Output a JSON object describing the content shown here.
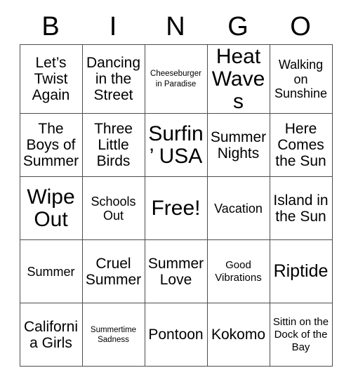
{
  "header": {
    "letters": [
      "B",
      "I",
      "N",
      "G",
      "O"
    ]
  },
  "grid": {
    "columns": 5,
    "rows": 5,
    "border_color": "#4d4d4d",
    "text_color": "#000000",
    "background_color": "#ffffff",
    "cells": [
      [
        {
          "label": "Let’s Twist Again",
          "size": "lg"
        },
        {
          "label": "Dancing in the Street",
          "size": "lg"
        },
        {
          "label": "Cheeseburger in Paradise",
          "size": "xs"
        },
        {
          "label": "Heat Waves",
          "size": "xxl"
        },
        {
          "label": "Walking on Sunshine",
          "size": "md"
        }
      ],
      [
        {
          "label": "The Boys of Summer",
          "size": "lg"
        },
        {
          "label": "Three Little Birds",
          "size": "lg"
        },
        {
          "label": "Surfin’ USA",
          "size": "xxl"
        },
        {
          "label": "Summer Nights",
          "size": "lg"
        },
        {
          "label": "Here Comes the Sun",
          "size": "lg"
        }
      ],
      [
        {
          "label": "Wipe Out",
          "size": "xxl"
        },
        {
          "label": "Schools Out",
          "size": "md"
        },
        {
          "label": "Free!",
          "size": "xxl"
        },
        {
          "label": "Vacation",
          "size": "md"
        },
        {
          "label": "Island in the Sun",
          "size": "lg"
        }
      ],
      [
        {
          "label": "Summer",
          "size": "md"
        },
        {
          "label": "Cruel Summer",
          "size": "lg"
        },
        {
          "label": "Summer Love",
          "size": "lg"
        },
        {
          "label": "Good Vibrations",
          "size": "sm"
        },
        {
          "label": "Riptide",
          "size": "xl"
        }
      ],
      [
        {
          "label": "California Girls",
          "size": "lg"
        },
        {
          "label": "Summertime Sadness",
          "size": "xs"
        },
        {
          "label": "Pontoon",
          "size": "lg"
        },
        {
          "label": "Kokomo",
          "size": "lg"
        },
        {
          "label": "Sittin on the Dock of the Bay",
          "size": "sm"
        }
      ]
    ]
  }
}
